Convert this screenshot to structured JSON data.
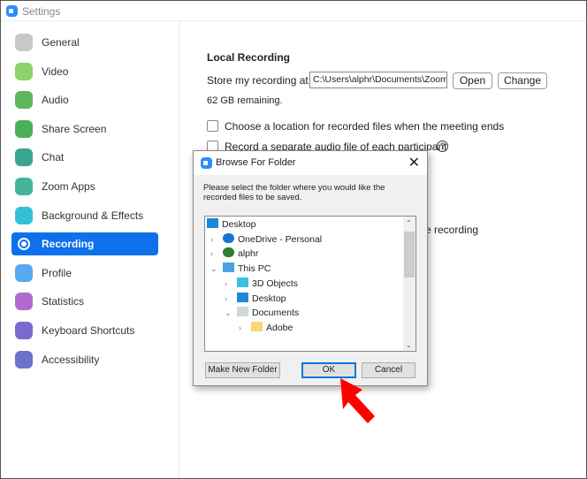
{
  "window": {
    "title": "Settings"
  },
  "sidebar": {
    "items": [
      {
        "label": "General",
        "color": "#c8c8c8"
      },
      {
        "label": "Video",
        "color": "#8ed26a"
      },
      {
        "label": "Audio",
        "color": "#5cb85c"
      },
      {
        "label": "Share Screen",
        "color": "#4cb05a"
      },
      {
        "label": "Chat",
        "color": "#3aa58f"
      },
      {
        "label": "Zoom Apps",
        "color": "#45b49a"
      },
      {
        "label": "Background & Effects",
        "color": "#35c0d8"
      },
      {
        "label": "Recording",
        "color": "#0e71eb",
        "active": true
      },
      {
        "label": "Profile",
        "color": "#56a8ef"
      },
      {
        "label": "Statistics",
        "color": "#b26ad0"
      },
      {
        "label": "Keyboard Shortcuts",
        "color": "#7a6ad0"
      },
      {
        "label": "Accessibility",
        "color": "#6a73c8"
      }
    ]
  },
  "recording": {
    "heading": "Local Recording",
    "store_label": "Store my recording at:",
    "path": "C:\\Users\\alphr\\Documents\\Zoom",
    "open": "Open",
    "change": "Change",
    "remaining": "62 GB remaining.",
    "opt1": "Choose a location for recorded files when the meeting ends",
    "opt2": "Record a separate audio file of each participant",
    "partial": "e recording"
  },
  "dialog": {
    "title": "Browse For Folder",
    "message": "Please select the folder where you would like the recorded files to be saved.",
    "tree": [
      {
        "label": "Desktop",
        "icon": "desktop-icon"
      },
      {
        "label": "OneDrive - Personal",
        "icon": "cloud-icon"
      },
      {
        "label": "alphr",
        "icon": "user-icon"
      },
      {
        "label": "This PC",
        "icon": "computer-icon"
      },
      {
        "label": "3D Objects",
        "icon": "cube-icon"
      },
      {
        "label": "Desktop",
        "icon": "desktop-icon"
      },
      {
        "label": "Documents",
        "icon": "document-icon"
      },
      {
        "label": "Adobe",
        "icon": "folder-icon"
      }
    ],
    "make_new_folder": "Make New Folder",
    "ok": "OK",
    "cancel": "Cancel"
  }
}
